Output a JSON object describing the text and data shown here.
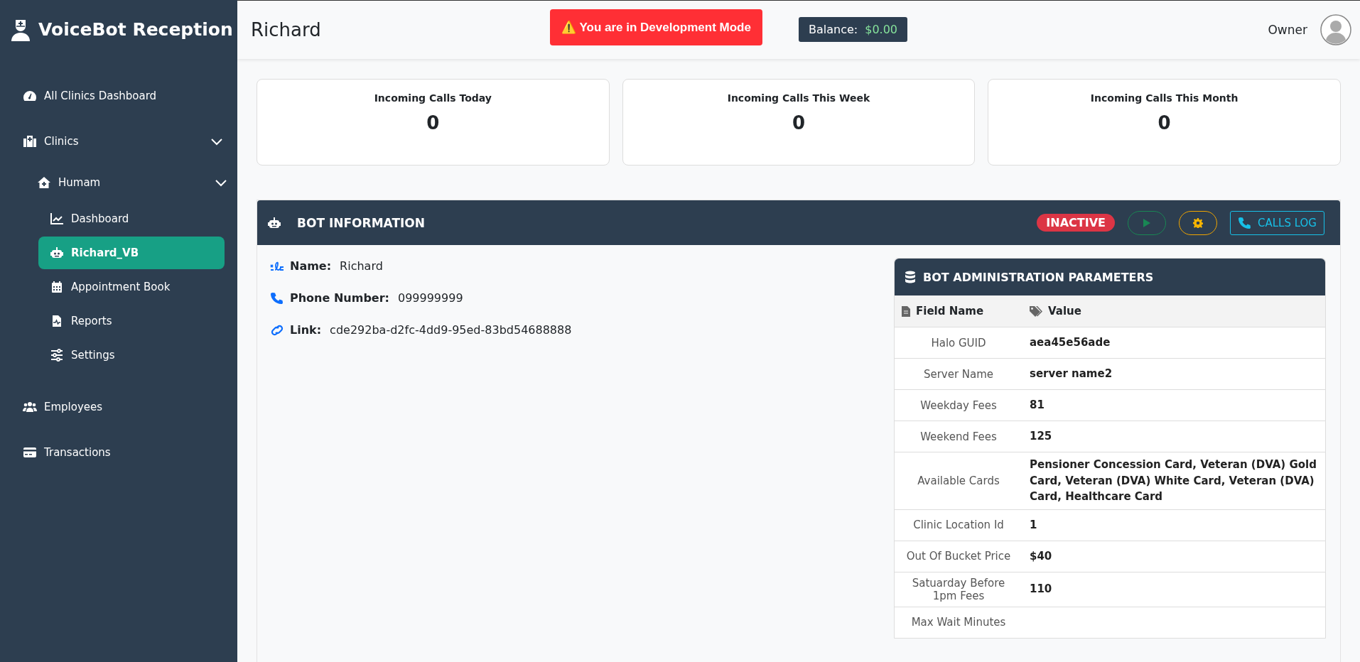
{
  "brand": {
    "title": "VoiceBot Reception"
  },
  "sidebar": {
    "items": [
      {
        "label": "All Clinics Dashboard",
        "selected": false
      },
      {
        "label": "Clinics",
        "selected": false,
        "expanded": true,
        "children": [
          {
            "label": "Humam",
            "selected": false,
            "expanded": true,
            "children": [
              {
                "label": "Dashboard",
                "selected": false
              },
              {
                "label": "Richard_VB",
                "selected": true
              },
              {
                "label": "Appointment Book",
                "selected": false
              },
              {
                "label": "Reports",
                "selected": false
              },
              {
                "label": "Settings",
                "selected": false
              }
            ]
          }
        ]
      },
      {
        "label": "Employees",
        "selected": false
      },
      {
        "label": "Transactions",
        "selected": false
      }
    ]
  },
  "header": {
    "title": "Richard",
    "dev_banner": "⚠️ You are in Development Mode",
    "balance_label": "Balance:",
    "balance_value": "$0.00",
    "user": "Owner"
  },
  "stats": [
    {
      "label": "Incoming Calls Today",
      "value": "0"
    },
    {
      "label": "Incoming Calls This Week",
      "value": "0"
    },
    {
      "label": "Incoming Calls This Month",
      "value": "0"
    }
  ],
  "bot_panel": {
    "title": "BOT INFORMATION",
    "status": {
      "label": "INACTIVE",
      "active": false
    },
    "calls_log": "CALLS LOG",
    "fields": [
      {
        "label": "Name:",
        "value": "Richard"
      },
      {
        "label": "Phone Number:",
        "value": "099999999"
      },
      {
        "label": "Link:",
        "value": "cde292ba-d2fc-4dd9-95ed-83bd54688888"
      }
    ]
  },
  "admin_table": {
    "title": "BOT ADMINISTRATION PARAMETERS",
    "columns": [
      "Field Name",
      "Value"
    ],
    "rows": [
      {
        "field": "Halo GUID",
        "value": "aea45e56ade"
      },
      {
        "field": "Server Name",
        "value": "server name2"
      },
      {
        "field": "Weekday Fees",
        "value": "81"
      },
      {
        "field": "Weekend Fees",
        "value": "125"
      },
      {
        "field": "Available Cards",
        "value": "Pensioner Concession Card, Veteran (DVA) Gold Card, Veteran (DVA) White Card, Veteran (DVA) Card, Healthcare Card"
      },
      {
        "field": "Clinic Location Id",
        "value": "1"
      },
      {
        "field": "Out Of Bucket Price",
        "value": "$40"
      },
      {
        "field": "Satuarday Before 1pm Fees",
        "value": "110"
      },
      {
        "field": "Max Wait Minutes"
      }
    ]
  }
}
